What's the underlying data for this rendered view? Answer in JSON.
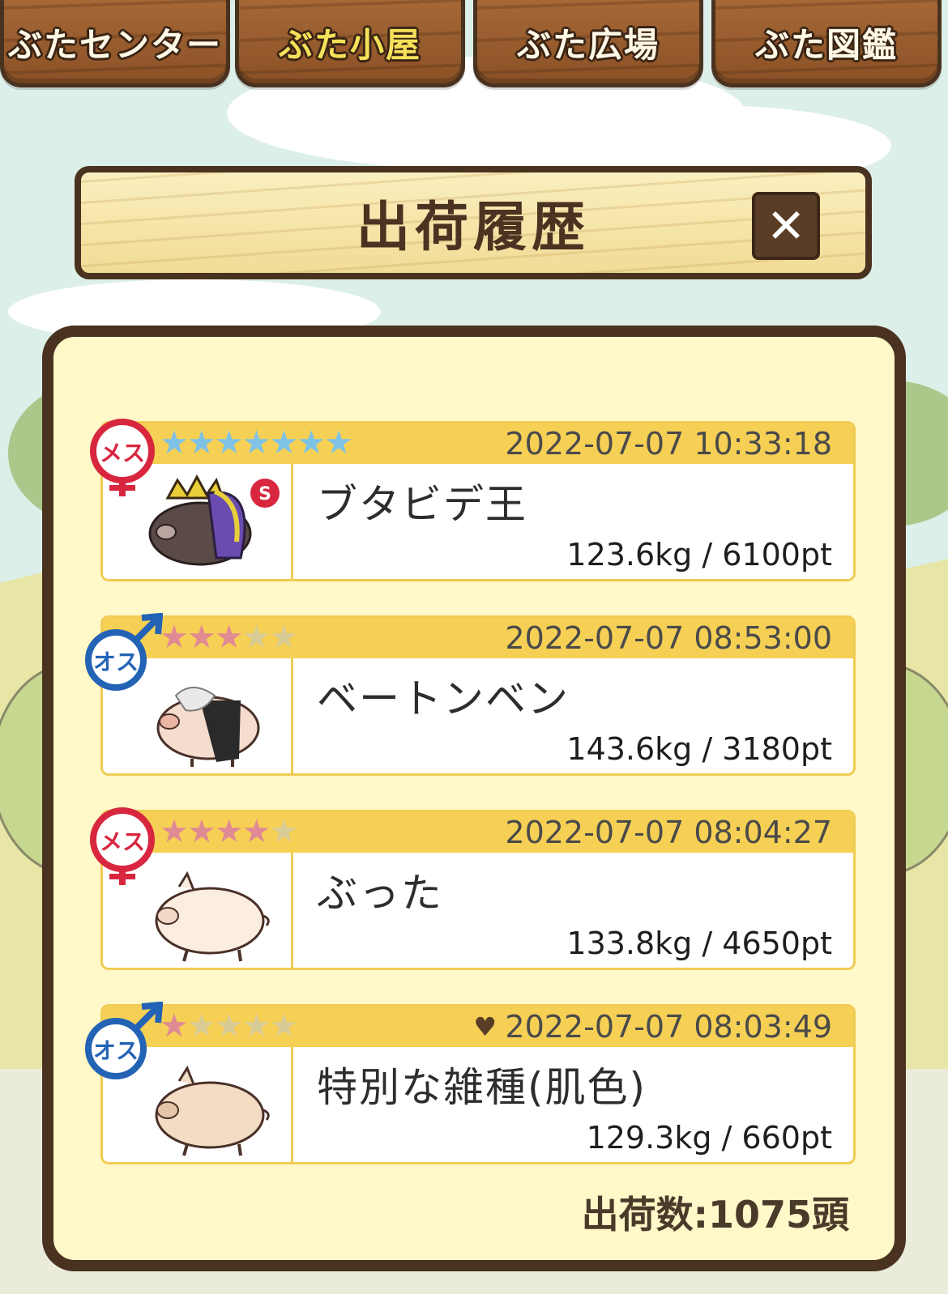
{
  "tabs": [
    {
      "label": "ぶたセンター",
      "active": false
    },
    {
      "label": "ぶた小屋",
      "active": true
    },
    {
      "label": "ぶた広場",
      "active": false
    },
    {
      "label": "ぶた図鑑",
      "active": false
    }
  ],
  "dialog": {
    "title": "出荷履歴",
    "close_icon": "close-icon"
  },
  "colors": {
    "wood_dark": "#4a3220",
    "header_yellow": "#f6d055",
    "star_blue": "#7ec3e6",
    "star_pink": "#e08a93",
    "star_empty": "#d9cb95",
    "female": "#d8263f",
    "male": "#2363b5"
  },
  "records": [
    {
      "gender": "メス",
      "gender_kind": "female",
      "rank": 7,
      "max_rank": 7,
      "star_color": "blue",
      "favorite": false,
      "datetime": "2022-07-07 10:33:18",
      "name": "ブタビデ王",
      "stats": "123.6kg / 6100pt",
      "badge": "S"
    },
    {
      "gender": "オス",
      "gender_kind": "male",
      "rank": 3,
      "max_rank": 5,
      "star_color": "pink",
      "favorite": false,
      "datetime": "2022-07-07 08:53:00",
      "name": "ベートンベン",
      "stats": "143.6kg / 3180pt"
    },
    {
      "gender": "メス",
      "gender_kind": "female",
      "rank": 4,
      "max_rank": 5,
      "star_color": "pink",
      "favorite": false,
      "datetime": "2022-07-07 08:04:27",
      "name": "ぶった",
      "stats": "133.8kg / 4650pt"
    },
    {
      "gender": "オス",
      "gender_kind": "male",
      "rank": 1,
      "max_rank": 5,
      "star_color": "pink",
      "favorite": true,
      "datetime": "2022-07-07 08:03:49",
      "name": "特別な雑種(肌色)",
      "stats": "129.3kg / 660pt"
    }
  ],
  "summary": {
    "count_label": "出荷数:1075頭"
  }
}
